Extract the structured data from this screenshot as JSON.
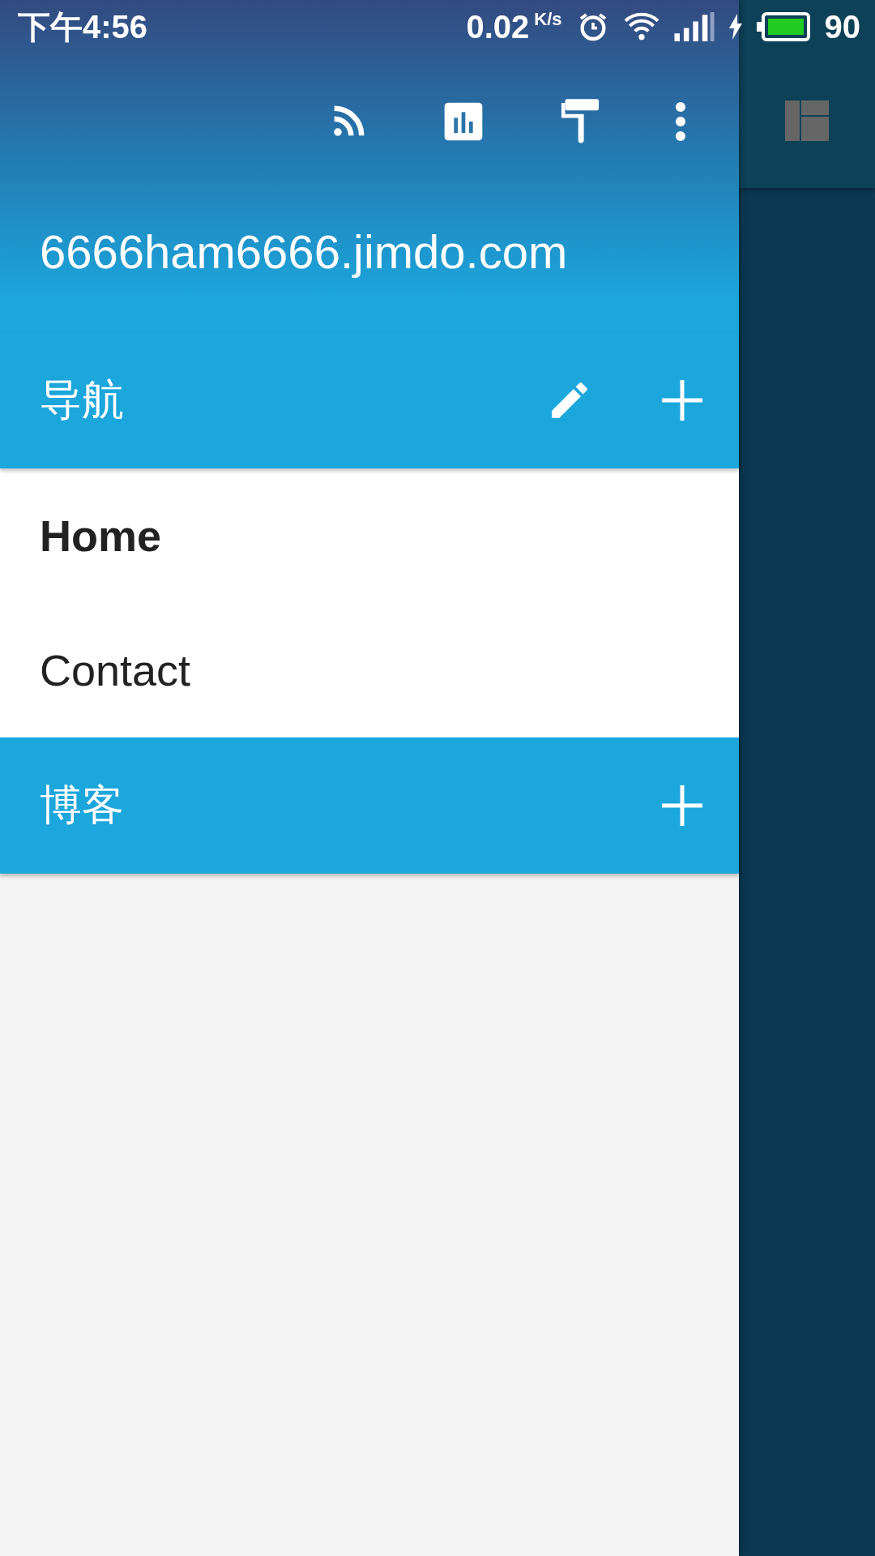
{
  "status_bar": {
    "time": "下午4:56",
    "speed": "0.02",
    "speed_unit": "K/s",
    "battery": "90"
  },
  "site_title": "6666ham6666.jimdo.com",
  "sections": [
    {
      "title": "导航",
      "actions": [
        {
          "kind": "edit"
        },
        {
          "kind": "add"
        }
      ],
      "items": [
        {
          "label": "Home",
          "selected": true
        },
        {
          "label": "Contact",
          "selected": false
        }
      ]
    },
    {
      "title": "博客",
      "actions": [
        {
          "kind": "add"
        }
      ]
    }
  ]
}
